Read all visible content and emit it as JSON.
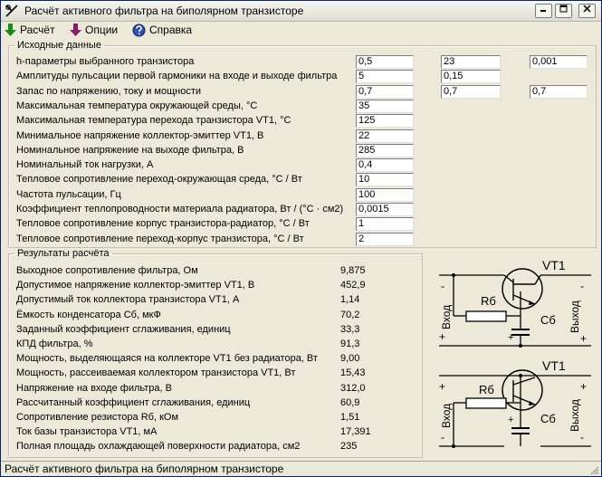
{
  "window": {
    "title": "Расчёт активного фильтра на биполярном транзисторе"
  },
  "menu": {
    "calc": "Расчёт",
    "options": "Опции",
    "help": "Справка"
  },
  "inputs": {
    "legend": "Исходные данные",
    "rows": [
      {
        "label": "h-параметры выбранного транзистора",
        "values": [
          "0,5",
          "23",
          "0,001"
        ]
      },
      {
        "label": "Амплитуды пульсации первой гармоники на входе и выходе фильтра",
        "values": [
          "5",
          "0,15"
        ]
      },
      {
        "label": "Запас по напряжению, току и мощности",
        "values": [
          "0,7",
          "0,7",
          "0,7"
        ]
      },
      {
        "label": "Максимальная температура окружающей среды, °С",
        "values": [
          "35"
        ]
      },
      {
        "label": "Максимальная температура перехода транзистора VT1, °С",
        "values": [
          "125"
        ]
      },
      {
        "label": "Минимальное напряжение коллектор-эмиттер VT1, В",
        "values": [
          "22"
        ]
      },
      {
        "label": "Номинальное напряжение на выходе фильтра, В",
        "values": [
          "285"
        ]
      },
      {
        "label": "Номинальный ток нагрузки, А",
        "values": [
          "0,4"
        ]
      },
      {
        "label": "Тепловое сопротивление переход-окружающая среда, °С / Вт",
        "values": [
          "10"
        ]
      },
      {
        "label": "Частота пульсации, Гц",
        "values": [
          "100"
        ]
      },
      {
        "label": "Коэффициент теплопроводности материала радиатора, Вт / (°С · см2)",
        "values": [
          "0,0015"
        ]
      },
      {
        "label": "Тепловое сопротивление корпус транзистора-радиатор, °С / Вт",
        "values": [
          "1"
        ]
      },
      {
        "label": "Тепловое сопротивление переход-корпус транзистора, °С / Вт",
        "values": [
          "2"
        ]
      }
    ]
  },
  "results": {
    "legend": "Результаты расчёта",
    "rows": [
      {
        "label": "Выходное сопротивление фильтра, Ом",
        "value": "9,875"
      },
      {
        "label": "Допустимое напряжение коллектор-эмиттер VT1, В",
        "value": "452,9"
      },
      {
        "label": "Допустимый ток коллектора транзистора VT1, А",
        "value": "1,14"
      },
      {
        "label": "Ёмкость конденсатора Сб, мкФ",
        "value": "70,2"
      },
      {
        "label": "Заданный коэффициент сглаживания, единиц",
        "value": "33,3"
      },
      {
        "label": "КПД фильтра, %",
        "value": "91,3"
      },
      {
        "label": "Мощность, выделяющаяся на коллекторе VT1 без радиатора, Вт",
        "value": "9,00"
      },
      {
        "label": "Мощность, рассеиваемая коллектором транзистора VT1, Вт",
        "value": "15,43"
      },
      {
        "label": "Напряжение на входе фильтра, В",
        "value": "312,0"
      },
      {
        "label": "Рассчитанный коэффициент сглаживания, единиц",
        "value": "60,9"
      },
      {
        "label": "Сопротивление резистора Rб, кОм",
        "value": "1,51"
      },
      {
        "label": "Ток базы транзистора VT1, мА",
        "value": "17,391"
      },
      {
        "label": "Полная площадь охлаждающей поверхности радиатора, см2",
        "value": "235"
      }
    ]
  },
  "schematic": {
    "transistor": "VT1",
    "resistor": "Rб",
    "capacitor": "Сб",
    "input": "Вход",
    "output": "Выход",
    "plus": "+",
    "minus": "-"
  },
  "status": {
    "text": "Расчёт активного фильтра на биполярном транзисторе"
  },
  "colors": {
    "calc_arrow": "#1a8a1a",
    "options_arrow": "#8a1a6a",
    "help_icon": "#3050b0"
  },
  "icons": {
    "app": "tool-icon",
    "calc": "arrow-down-icon",
    "options": "arrow-down-icon",
    "help": "help-globe-icon"
  }
}
